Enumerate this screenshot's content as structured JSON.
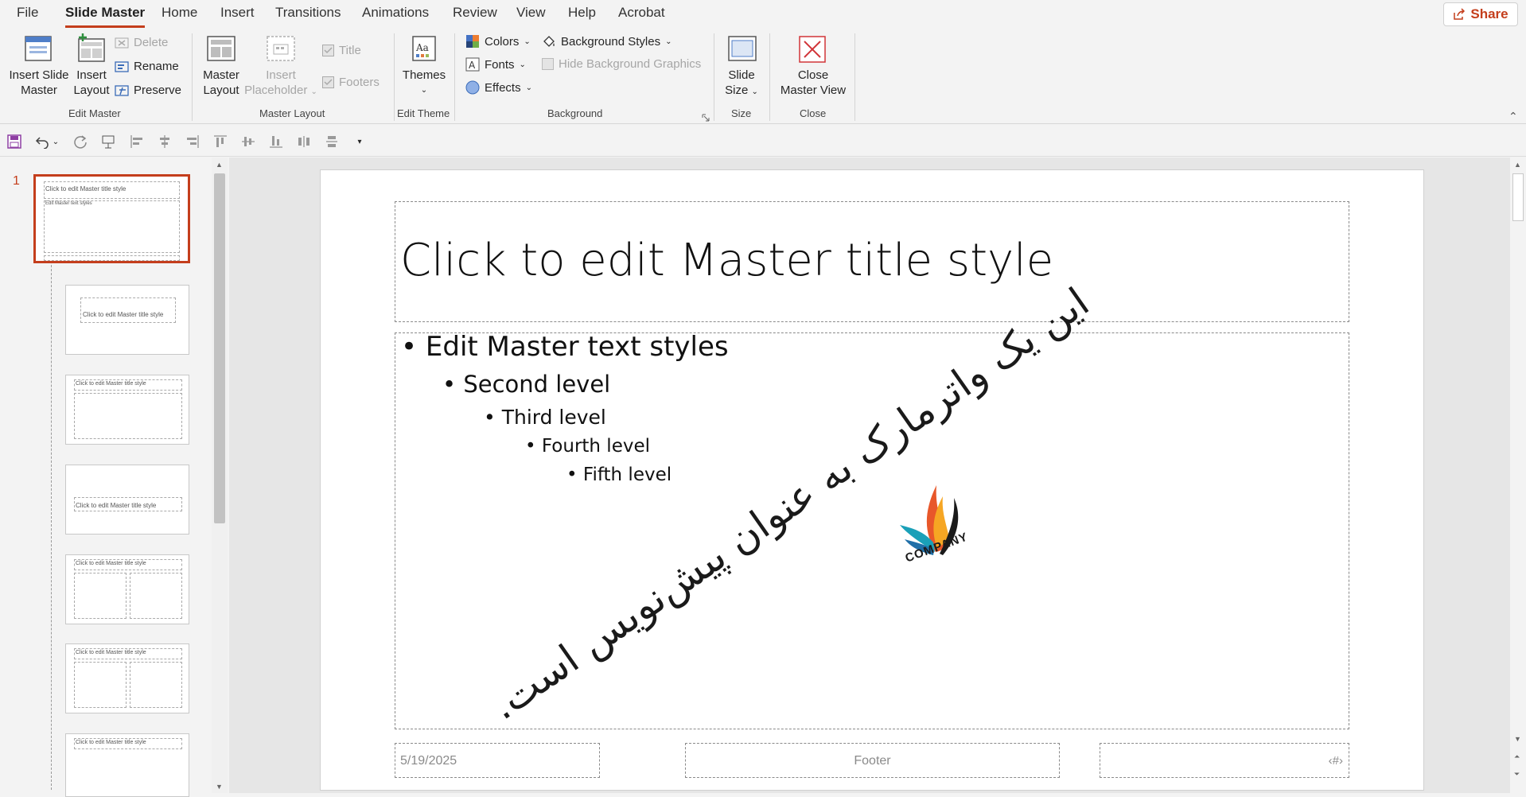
{
  "tabs": {
    "file": "File",
    "slide_master": "Slide Master",
    "home": "Home",
    "insert": "Insert",
    "transitions": "Transitions",
    "animations": "Animations",
    "review": "Review",
    "view": "View",
    "help": "Help",
    "acrobat": "Acrobat",
    "share": "Share"
  },
  "ribbon": {
    "edit_master": {
      "insert_slide_master_1": "Insert Slide",
      "insert_slide_master_2": "Master",
      "insert_layout_1": "Insert",
      "insert_layout_2": "Layout",
      "delete": "Delete",
      "rename": "Rename",
      "preserve": "Preserve",
      "group": "Edit Master"
    },
    "master_layout": {
      "master_layout_1": "Master",
      "master_layout_2": "Layout",
      "insert_placeholder_1": "Insert",
      "insert_placeholder_2": "Placeholder",
      "title": "Title",
      "footers": "Footers",
      "group": "Master Layout"
    },
    "edit_theme": {
      "themes": "Themes",
      "group": "Edit Theme"
    },
    "background": {
      "colors": "Colors",
      "fonts": "Fonts",
      "effects": "Effects",
      "background_styles": "Background Styles",
      "hide_background_graphics": "Hide Background Graphics",
      "group": "Background"
    },
    "size": {
      "slide_size_1": "Slide",
      "slide_size_2": "Size",
      "group": "Size"
    },
    "close": {
      "close_master_view_1": "Close",
      "close_master_view_2": "Master View",
      "group": "Close"
    }
  },
  "thumbnails": {
    "selected_number": "1",
    "master_title": "Click to edit Master title style",
    "master_text": "Edit Master text styles"
  },
  "slide": {
    "title": "Click to edit Master title style",
    "level1": "Edit Master text styles",
    "level2": "Second level",
    "level3": "Third level",
    "level4": "Fourth level",
    "level5": "Fifth level",
    "watermark": "این یک واترمارک به عنوان پیش‌نویس است.",
    "logo_text": "COMPANY",
    "date": "5/19/2025",
    "footer": "Footer",
    "slide_number": "‹#›"
  },
  "colors": {
    "accent": "#c43e1c",
    "ribbon_bg": "#f3f3f3",
    "editor_bg": "#e6e6e6"
  }
}
